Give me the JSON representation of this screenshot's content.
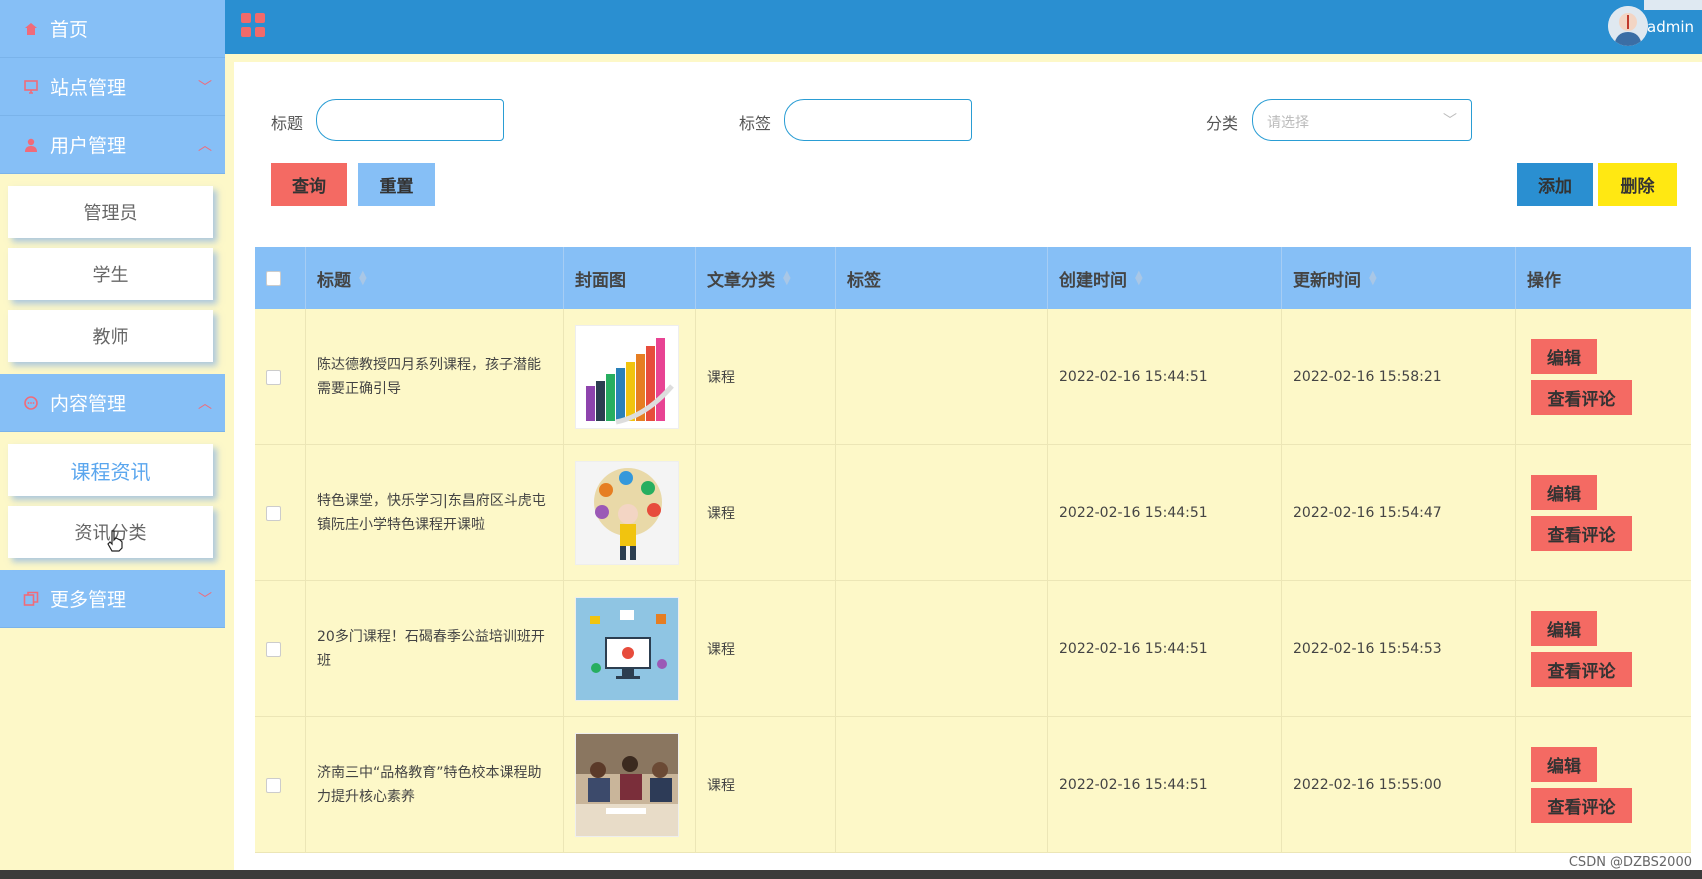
{
  "header": {
    "user": "admin"
  },
  "sidebar": {
    "home": "首页",
    "site_mgmt": "站点管理",
    "user_mgmt": "用户管理",
    "user_items": [
      "管理员",
      "学生",
      "教师"
    ],
    "content_mgmt": "内容管理",
    "content_items": [
      "课程资讯",
      "资讯分类"
    ],
    "more_mgmt": "更多管理"
  },
  "search": {
    "title_label": "标题",
    "tag_label": "标签",
    "category_label": "分类",
    "category_placeholder": "请选择"
  },
  "buttons": {
    "query": "查询",
    "reset": "重置",
    "add": "添加",
    "delete": "删除"
  },
  "table": {
    "headers": [
      "标题",
      "封面图",
      "文章分类",
      "标签",
      "创建时间",
      "更新时间",
      "操作"
    ],
    "rows": [
      {
        "title": "陈达德教授四月系列课程，孩子潜能需要正确引导",
        "category": "课程",
        "tag": "",
        "created": "2022-02-16 15:44:51",
        "updated": "2022-02-16 15:58:21"
      },
      {
        "title": "特色课堂，快乐学习|东昌府区斗虎屯镇阮庄小学特色课程开课啦",
        "category": "课程",
        "tag": "",
        "created": "2022-02-16 15:44:51",
        "updated": "2022-02-16 15:54:47"
      },
      {
        "title": "20多门课程！石碣春季公益培训班开班",
        "category": "课程",
        "tag": "",
        "created": "2022-02-16 15:44:51",
        "updated": "2022-02-16 15:54:53"
      },
      {
        "title": "济南三中“品格教育”特色校本课程助力提升核心素养",
        "category": "课程",
        "tag": "",
        "created": "2022-02-16 15:44:51",
        "updated": "2022-02-16 15:55:00"
      }
    ],
    "edit_label": "编辑",
    "comment_label": "查看评论"
  },
  "watermark": "CSDN @DZBS2000",
  "colors": {
    "sidebar": "#86bff6",
    "topbar": "#2a8fd1",
    "row_bg": "#fdf8c8",
    "danger": "#f46a63",
    "primary": "#2a8fd1",
    "warning": "#ffe812"
  }
}
